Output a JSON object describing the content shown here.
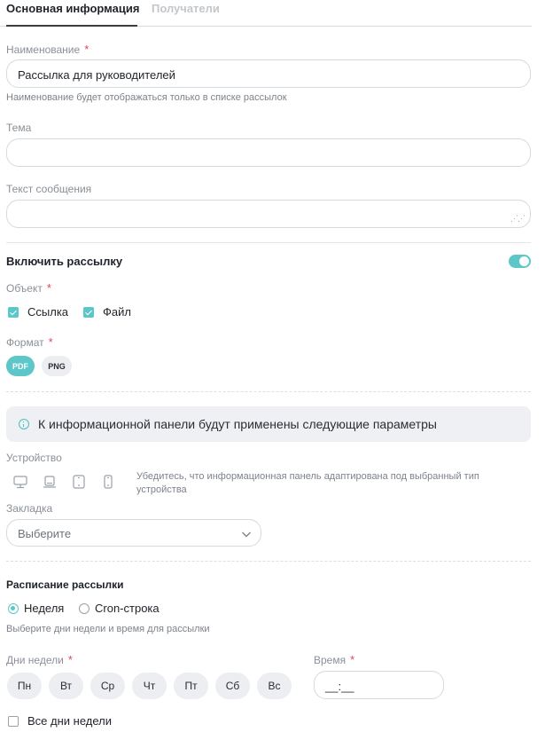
{
  "tabs": [
    {
      "label": "Основная информация",
      "active": true
    },
    {
      "label": "Получатели",
      "active": false
    }
  ],
  "name_field": {
    "label": "Наименование",
    "required_mark": "*",
    "value": "Рассылка для руководителей",
    "hint": "Наименование будет отображаться только в списке рассылок"
  },
  "subject_field": {
    "label": "Тема",
    "value": ""
  },
  "message_field": {
    "label": "Текст сообщения",
    "value": ""
  },
  "enable_mailing": {
    "label": "Включить рассылку",
    "enabled": true
  },
  "object_field": {
    "label": "Объект",
    "required_mark": "*",
    "options": [
      {
        "label": "Ссылка",
        "checked": true
      },
      {
        "label": "Файл",
        "checked": true
      }
    ]
  },
  "format_field": {
    "label": "Формат",
    "required_mark": "*",
    "options": [
      {
        "label": "PDF",
        "selected": true
      },
      {
        "label": "PNG",
        "selected": false
      }
    ]
  },
  "info_banner": {
    "text": "К информационной панели будут применены следующие параметры"
  },
  "device_field": {
    "label": "Устройство",
    "icons": [
      "desktop-icon",
      "laptop-icon",
      "tablet-icon",
      "phone-icon"
    ],
    "hint_line1": "Убедитесь, что информационная панель адаптирована под выбранный тип",
    "hint_line2": "устройства"
  },
  "bookmark_field": {
    "label": "Закладка",
    "placeholder": "Выберите"
  },
  "schedule": {
    "title": "Расписание рассылки",
    "modes": [
      {
        "label": "Неделя",
        "selected": true
      },
      {
        "label": "Cron-строка",
        "selected": false
      }
    ],
    "hint": "Выберите дни недели и время для рассылки"
  },
  "days_field": {
    "label": "Дни недели",
    "required_mark": "*",
    "days": [
      "Пн",
      "Вт",
      "Ср",
      "Чт",
      "Пт",
      "Сб",
      "Вс"
    ],
    "all_days_label": "Все дни недели",
    "all_days_checked": false
  },
  "time_field": {
    "label": "Время",
    "required_mark": "*",
    "placeholder": "__:__"
  },
  "colors": {
    "accent": "#5cc6c8",
    "required": "#e0465a",
    "chip_bg": "#eceef1"
  }
}
